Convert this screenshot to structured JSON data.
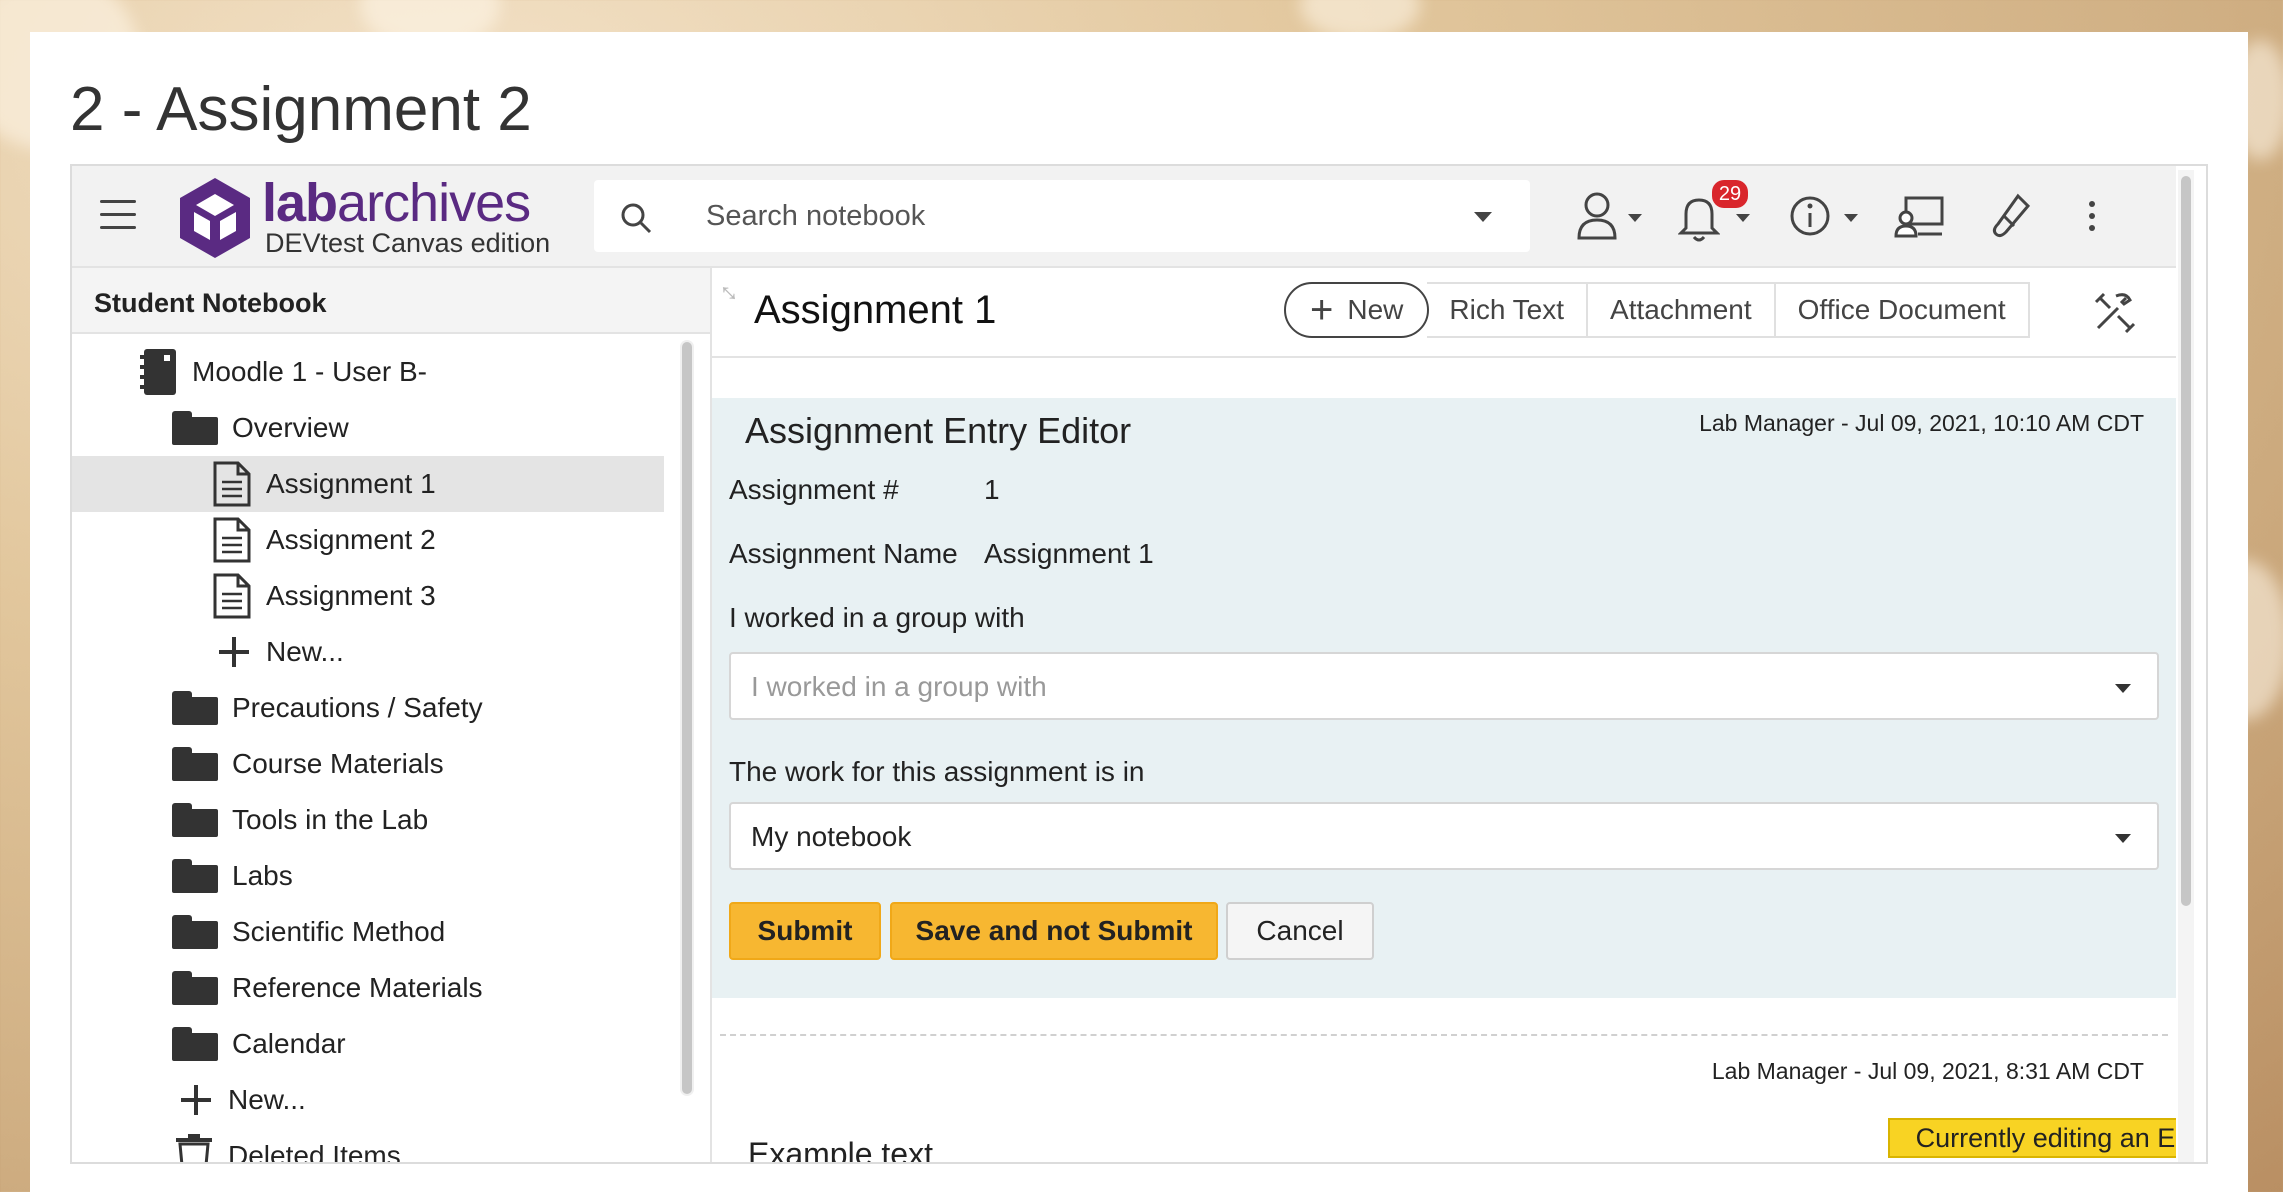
{
  "page": {
    "title": "2 - Assignment 2"
  },
  "header": {
    "brand_bold": "lab",
    "brand_rest": "archives",
    "edition": "DEVtest Canvas edition",
    "search_placeholder": "Search notebook",
    "notifications_count": "29"
  },
  "sidebar": {
    "title": "Student Notebook",
    "notebook": "Moodle 1 - User B-",
    "overview": "Overview",
    "pages": [
      "Assignment 1",
      "Assignment 2",
      "Assignment 3"
    ],
    "new_page": "New...",
    "folders": [
      "Precautions / Safety",
      "Course Materials",
      "Tools in the Lab",
      "Labs",
      "Scientific Method",
      "Reference Materials",
      "Calendar"
    ],
    "new_folder": "New...",
    "deleted": "Deleted Items"
  },
  "main": {
    "page_name": "Assignment 1",
    "buttons": {
      "new": "New",
      "rich_text": "Rich Text",
      "attachment": "Attachment",
      "office_document": "Office Document"
    },
    "editor": {
      "title": "Assignment Entry Editor",
      "meta": "Lab Manager - Jul 09, 2021, 10:10 AM CDT",
      "assignment_num_label": "Assignment #",
      "assignment_num_value": "1",
      "assignment_name_label": "Assignment Name",
      "assignment_name_value": "Assignment 1",
      "group_label": "I worked in a group with",
      "group_placeholder": "I worked in a group with",
      "work_label": "The work for this assignment is in",
      "work_value": "My notebook",
      "submit": "Submit",
      "save_not_submit": "Save and not Submit",
      "cancel": "Cancel"
    },
    "entry2": {
      "meta": "Lab Manager - Jul 09, 2021, 8:31 AM CDT",
      "text": "Example text",
      "editing_badge": "Currently editing an Entry"
    }
  },
  "colors": {
    "brand": "#5a2a82",
    "primary_button": "#f7b731",
    "editor_bg": "#e8f1f3",
    "badge": "#d9262c"
  }
}
